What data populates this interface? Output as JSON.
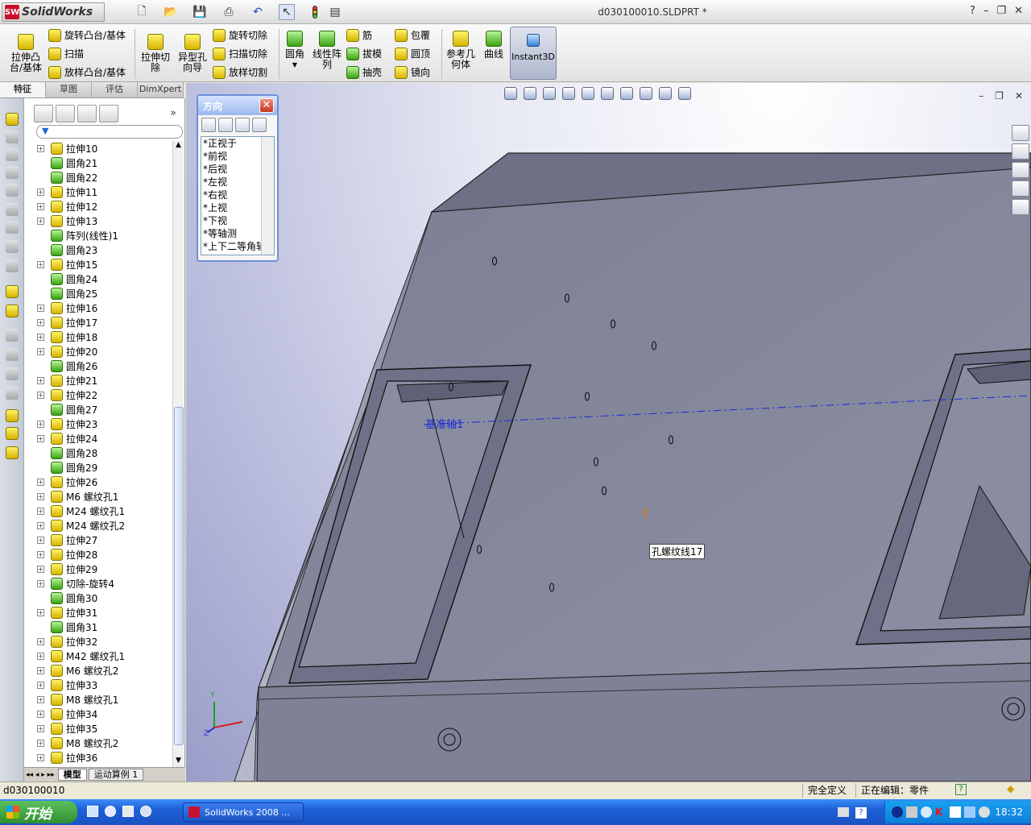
{
  "app": {
    "logo_text": "SolidWorks",
    "doc_title": "d030100010.SLDPRT *",
    "help_label": "?"
  },
  "command_manager": {
    "features": {
      "extrude_boss": "拉伸凸\n台/基体",
      "revolve_boss": "旋转凸台/基体",
      "sweep": "扫描",
      "loft_boss": "放样凸台/基体",
      "extrude_cut": "拉伸切\n除",
      "hole_wizard": "异型孔\n向导",
      "revolve_cut": "旋转切除",
      "sweep_cut": "扫描切除",
      "loft_cut": "放样切割",
      "fillet": "圆角",
      "linear_pattern": "线性阵\n列",
      "rib": "筋",
      "draft": "拔模",
      "shell": "抽壳",
      "wrap": "包覆",
      "dome": "圆顶",
      "mirror": "镜向",
      "ref_geometry": "参考几\n何体",
      "curves": "曲线",
      "instant3d": "Instant3D"
    }
  },
  "tabs": [
    "特征",
    "草图",
    "评估",
    "DimXpert"
  ],
  "feature_tree": [
    {
      "label": "拉伸10",
      "type": "extrude",
      "expand": true
    },
    {
      "label": "圆角21",
      "type": "fillet",
      "expand": false
    },
    {
      "label": "圆角22",
      "type": "fillet",
      "expand": false
    },
    {
      "label": "拉伸11",
      "type": "extrude",
      "expand": true
    },
    {
      "label": "拉伸12",
      "type": "extrude",
      "expand": true
    },
    {
      "label": "拉伸13",
      "type": "extrude",
      "expand": true
    },
    {
      "label": "阵列(线性)1",
      "type": "pattern",
      "expand": false
    },
    {
      "label": "圆角23",
      "type": "fillet",
      "expand": false
    },
    {
      "label": "拉伸15",
      "type": "extrude",
      "expand": true
    },
    {
      "label": "圆角24",
      "type": "fillet",
      "expand": false
    },
    {
      "label": "圆角25",
      "type": "fillet",
      "expand": false
    },
    {
      "label": "拉伸16",
      "type": "extrude",
      "expand": true
    },
    {
      "label": "拉伸17",
      "type": "extrude",
      "expand": true
    },
    {
      "label": "拉伸18",
      "type": "extrude",
      "expand": true
    },
    {
      "label": "拉伸20",
      "type": "extrude",
      "expand": true
    },
    {
      "label": "圆角26",
      "type": "fillet",
      "expand": false
    },
    {
      "label": "拉伸21",
      "type": "extrude",
      "expand": true
    },
    {
      "label": "拉伸22",
      "type": "extrude",
      "expand": true
    },
    {
      "label": "圆角27",
      "type": "fillet",
      "expand": false
    },
    {
      "label": "拉伸23",
      "type": "extrude",
      "expand": true
    },
    {
      "label": "拉伸24",
      "type": "extrude",
      "expand": true
    },
    {
      "label": "圆角28",
      "type": "fillet",
      "expand": false
    },
    {
      "label": "圆角29",
      "type": "fillet",
      "expand": false
    },
    {
      "label": "拉伸26",
      "type": "extrude",
      "expand": true
    },
    {
      "label": "M6 螺纹孔1",
      "type": "hole",
      "expand": true
    },
    {
      "label": "M24 螺纹孔1",
      "type": "hole",
      "expand": true
    },
    {
      "label": "M24 螺纹孔2",
      "type": "hole",
      "expand": true
    },
    {
      "label": "拉伸27",
      "type": "extrude",
      "expand": true
    },
    {
      "label": "拉伸28",
      "type": "extrude",
      "expand": true
    },
    {
      "label": "拉伸29",
      "type": "extrude",
      "expand": true
    },
    {
      "label": "切除-旋转4",
      "type": "revcut",
      "expand": true
    },
    {
      "label": "圆角30",
      "type": "fillet",
      "expand": false
    },
    {
      "label": "拉伸31",
      "type": "extrude",
      "expand": true
    },
    {
      "label": "圆角31",
      "type": "fillet",
      "expand": false
    },
    {
      "label": "拉伸32",
      "type": "extrude",
      "expand": true
    },
    {
      "label": "M42 螺纹孔1",
      "type": "hole",
      "expand": true
    },
    {
      "label": "M6 螺纹孔2",
      "type": "hole",
      "expand": true
    },
    {
      "label": "拉伸33",
      "type": "extrude",
      "expand": true
    },
    {
      "label": "M8 螺纹孔1",
      "type": "hole",
      "expand": true
    },
    {
      "label": "拉伸34",
      "type": "extrude",
      "expand": true
    },
    {
      "label": "拉伸35",
      "type": "extrude",
      "expand": true
    },
    {
      "label": "M8 螺纹孔2",
      "type": "hole",
      "expand": true
    },
    {
      "label": "拉伸36",
      "type": "extrude",
      "expand": true
    }
  ],
  "bottom_tabs": [
    "模型",
    "运动算例 1"
  ],
  "orientation": {
    "title": "方向",
    "views": [
      "*正视于",
      "*前视",
      "*后视",
      "*左视",
      "*右视",
      "*上视",
      "*下视",
      "*等轴测",
      "*上下二等角轴"
    ]
  },
  "viewport": {
    "axis_label": "基准轴1",
    "tooltip": "孔螺纹线17",
    "accent": "#1a2ad8"
  },
  "status": {
    "left": "d030100010",
    "defined": "完全定义",
    "editing": "正在编辑：零件",
    "help": "?"
  },
  "taskbar": {
    "start": "开始",
    "item": "SolidWorks 2008 ...",
    "clock": "18:32"
  }
}
